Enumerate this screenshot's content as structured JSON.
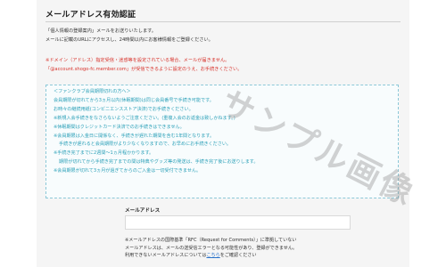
{
  "page": {
    "title": "メールアドレス有効認証"
  },
  "intro": {
    "line1": "「個人情報の登録案内」メールをお送りいたします。",
    "line2": "メールに記載のURLにアクセスし、24時間以内にお客様情報をご登録ください。"
  },
  "warning": {
    "line1": "※ドメイン（アドレス）指定受信・迷惑等を設定されている場合、メールが届きません。",
    "line2_prefix": "「",
    "address": "@account.shogo-fc.member.com",
    "line2_suffix": "」が受信できるように設定のうえ、お手続きください。"
  },
  "notice": {
    "lines": [
      {
        "text": "＜ファンクラブ会員期限切れの方へ＞",
        "indent": false
      },
      {
        "text": "会員期限が切れてから3ヵ月以内(休眠期間)は同じ会員番号で手続き可能です。",
        "indent": false
      },
      {
        "text": "お時々の継続用紙(コンビニエンスストア決済)でお手続きください。",
        "indent": false
      },
      {
        "text": "※新規入会手続きをなさらないようご注意ください。(重複入会のお返金は致しかねます。)",
        "indent": false
      },
      {
        "text": "※休眠期間はクレジットカード決済でのお手続きはできません。",
        "indent": false
      },
      {
        "text": "※会員期限は入金日に開係なく、手続きが遅れた期間を含む1年間となります。",
        "indent": false
      },
      {
        "text": "手続きが遅れると会員期限がより少なくなりますので、お早めにお手続きください。",
        "indent": true
      },
      {
        "text": "※手続き完了までに2週間〜1ヵ月程かかります。",
        "indent": false
      },
      {
        "text": "期限が切れてから手続き完了までの間は特典やグッズ等の発送は、手続き完了後にお送りします。",
        "indent": true
      },
      {
        "text": "※会員期限が切れて3ヵ月が過ぎてからのご入金は一切受付できません。",
        "indent": false
      }
    ]
  },
  "email_field": {
    "label": "メールアドレス",
    "value": "",
    "placeholder": ""
  },
  "footnote": {
    "line1": "※メールアドレスの国際基準「RFC（Request for Comments）」に準拠していない",
    "line2": "メールアドレスは、メールの送受信エラーとなる可能性があり、登録ができません。",
    "line3_prefix": "利用できないメールアドレスについては",
    "link": "こちら",
    "line3_suffix": "をご確認ください"
  },
  "watermark": {
    "text": "サンプル画像"
  },
  "colors": {
    "warning": "#d8332c",
    "notice": "#2ba0b8",
    "link": "#2a72c9"
  }
}
